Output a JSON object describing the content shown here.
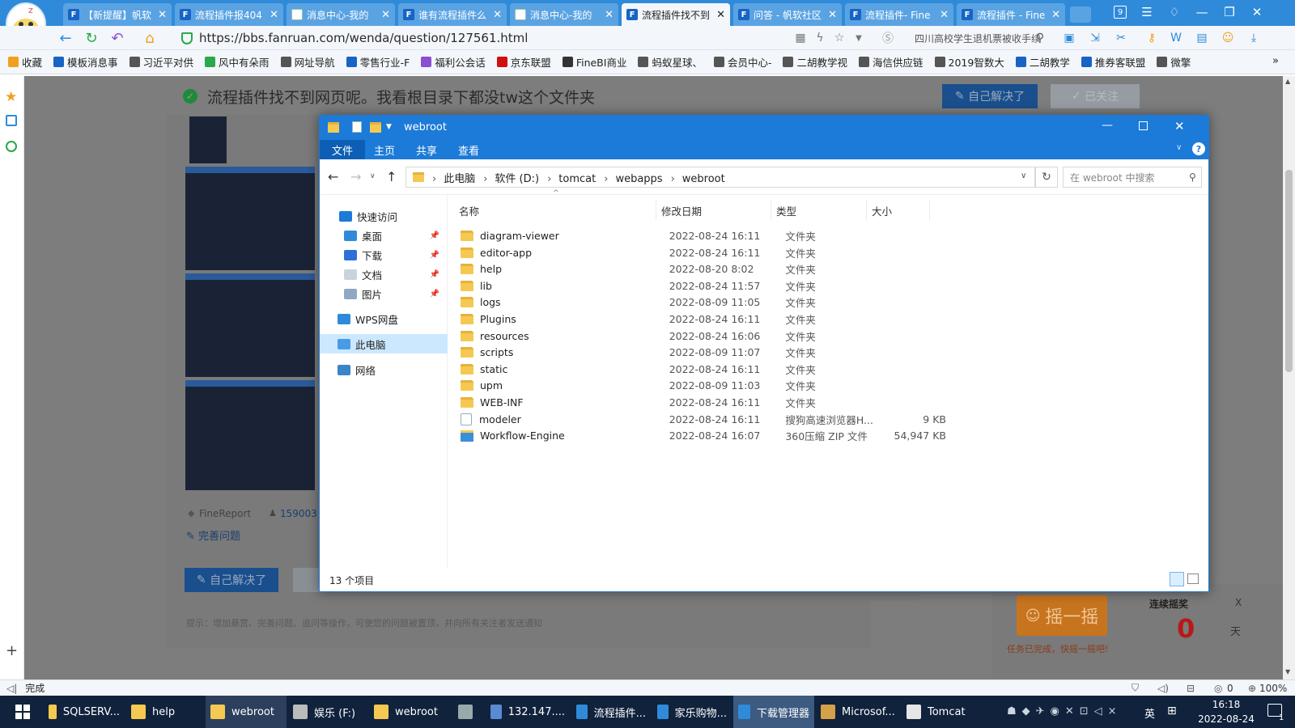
{
  "browser": {
    "tabs": [
      {
        "label": "【新提醒】帆软",
        "fav": "F",
        "doc": false
      },
      {
        "label": "流程插件报404",
        "fav": "F",
        "doc": false
      },
      {
        "label": "消息中心-我的",
        "fav": "",
        "doc": true
      },
      {
        "label": "谁有流程插件么",
        "fav": "F",
        "doc": false
      },
      {
        "label": "消息中心-我的",
        "fav": "",
        "doc": true
      },
      {
        "label": "流程插件找不到",
        "fav": "F",
        "doc": false,
        "active": true
      },
      {
        "label": "问答 - 帆软社区",
        "fav": "F",
        "doc": false
      },
      {
        "label": "流程插件- Fine",
        "fav": "F",
        "doc": false
      },
      {
        "label": "流程插件 - Fine",
        "fav": "F",
        "doc": false
      }
    ],
    "tab_badge": "9",
    "url": "https://bbs.fanruan.com/wenda/question/127561.html",
    "search_text": "四川高校学生退机票被收手续",
    "bookmarks": [
      "收藏",
      "模板消息事",
      "习近平对供",
      "风中有朵雨",
      "网址导航",
      "零售行业-F",
      "福利公会话",
      "京东联盟",
      "FineBI商业",
      "蚂蚁星球、",
      "会员中心-",
      "二胡教学视",
      "海信供应链",
      "2019智数大",
      "二胡教学",
      "推券客联盟",
      "微擎"
    ],
    "status": "完成",
    "status_right": {
      "zero": "0",
      "zoom": "100%"
    }
  },
  "page": {
    "title": "流程插件找不到网页呢。我看根目录下都没tw这个文件夹",
    "btn_solved": "自己解决了",
    "btn_follow": "已关注",
    "tag": "FineReport",
    "uid": "159003",
    "improve": "完善问题",
    "btn_solved2": "自己解决了",
    "hint": "提示：增加悬赏、完善问题、追问等操作，可使您的问题被置顶，并向所有关注者发送通知",
    "shake": "摇一摇",
    "shake_sub": "任务已完成，快摇一摇吧!",
    "streak_label": "连续摇奖",
    "streak_value": "0",
    "streak_unit": "天",
    "close_x": "X"
  },
  "explorer": {
    "title": "webroot",
    "ribbon": [
      "文件",
      "主页",
      "共享",
      "查看"
    ],
    "crumbs": [
      "此电脑",
      "软件 (D:)",
      "tomcat",
      "webapps",
      "webroot"
    ],
    "search_placeholder": "在 webroot 中搜索",
    "nav": [
      {
        "label": "快速访问",
        "pin": false
      },
      {
        "label": "桌面",
        "pin": true
      },
      {
        "label": "下载",
        "pin": true
      },
      {
        "label": "文档",
        "pin": true
      },
      {
        "label": "图片",
        "pin": true
      },
      {
        "label": "WPS网盘",
        "pin": false
      },
      {
        "label": "此电脑",
        "pin": false
      },
      {
        "label": "网络",
        "pin": false
      }
    ],
    "columns": [
      "名称",
      "修改日期",
      "类型",
      "大小"
    ],
    "files": [
      {
        "name": "diagram-viewer",
        "date": "2022-08-24 16:11",
        "type": "文件夹",
        "size": "",
        "kind": "folder"
      },
      {
        "name": "editor-app",
        "date": "2022-08-24 16:11",
        "type": "文件夹",
        "size": "",
        "kind": "folder"
      },
      {
        "name": "help",
        "date": "2022-08-20 8:02",
        "type": "文件夹",
        "size": "",
        "kind": "folder"
      },
      {
        "name": "lib",
        "date": "2022-08-24 11:57",
        "type": "文件夹",
        "size": "",
        "kind": "folder"
      },
      {
        "name": "logs",
        "date": "2022-08-09 11:05",
        "type": "文件夹",
        "size": "",
        "kind": "folder"
      },
      {
        "name": "Plugins",
        "date": "2022-08-24 16:11",
        "type": "文件夹",
        "size": "",
        "kind": "folder"
      },
      {
        "name": "resources",
        "date": "2022-08-24 16:06",
        "type": "文件夹",
        "size": "",
        "kind": "folder"
      },
      {
        "name": "scripts",
        "date": "2022-08-09 11:07",
        "type": "文件夹",
        "size": "",
        "kind": "folder"
      },
      {
        "name": "static",
        "date": "2022-08-24 16:11",
        "type": "文件夹",
        "size": "",
        "kind": "folder"
      },
      {
        "name": "upm",
        "date": "2022-08-09 11:03",
        "type": "文件夹",
        "size": "",
        "kind": "folder"
      },
      {
        "name": "WEB-INF",
        "date": "2022-08-24 16:11",
        "type": "文件夹",
        "size": "",
        "kind": "folder"
      },
      {
        "name": "modeler",
        "date": "2022-08-24 16:11",
        "type": "搜狗高速浏览器H...",
        "size": "9 KB",
        "kind": "html"
      },
      {
        "name": "Workflow-Engine",
        "date": "2022-08-24 16:07",
        "type": "360压缩 ZIP 文件",
        "size": "54,947 KB",
        "kind": "zip"
      }
    ],
    "count": "13 个项目"
  },
  "taskbar": {
    "items": [
      "SQLSERV...",
      "help",
      "webroot",
      "娱乐 (F:)",
      "webroot",
      "",
      "132.147....",
      "流程插件...",
      "家乐购物...",
      "下载管理器",
      "Microsof...",
      "Tomcat"
    ],
    "ime": "英",
    "time": "16:18",
    "date": "2022-08-24",
    "notif": "1"
  },
  "colors": {
    "browser_blue": "#2f8bd9",
    "explorer_blue": "#1c7ad8",
    "taskbar": "#10223c",
    "primary_btn": "#1e6fd0",
    "shake": "#f08a1c",
    "streak": "#e02020"
  }
}
